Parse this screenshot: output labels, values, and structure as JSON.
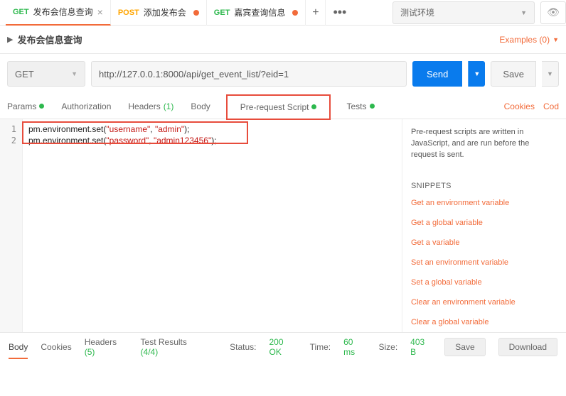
{
  "tabs": [
    {
      "method": "GET",
      "label": "发布会信息查询",
      "active": true
    },
    {
      "method": "POST",
      "label": "添加发布会",
      "active": false
    },
    {
      "method": "GET",
      "label": "嘉宾查询信息",
      "active": false
    }
  ],
  "environment": "测试环境",
  "request": {
    "title": "发布会信息查询",
    "examples": "Examples (0)",
    "method": "GET",
    "url": "http://127.0.0.1:8000/api/get_event_list/?eid=1",
    "send": "Send",
    "save": "Save"
  },
  "req_tabs": {
    "params": "Params",
    "authorization": "Authorization",
    "headers": "Headers",
    "headers_count": "(1)",
    "body": "Body",
    "prerequest": "Pre-request Script",
    "tests": "Tests",
    "cookies": "Cookies",
    "code": "Cod"
  },
  "editor": {
    "line1_a": "pm.environment.set(",
    "line1_s1": "\"username\"",
    "line1_b": ", ",
    "line1_s2": "\"admin\"",
    "line1_c": ");",
    "line2_a": "pm.environment.set(",
    "line2_s1": "\"password\"",
    "line2_b": ", ",
    "line2_s2": "\"admin123456\"",
    "line2_c": ");"
  },
  "side": {
    "desc": "Pre-request scripts are written in JavaScript, and are run before the request is sent.",
    "heading": "SNIPPETS",
    "snippets": [
      "Get an environment variable",
      "Get a global variable",
      "Get a variable",
      "Set an environment variable",
      "Set a global variable",
      "Clear an environment variable",
      "Clear a global variable"
    ]
  },
  "footer": {
    "body": "Body",
    "cookies": "Cookies",
    "headers": "Headers",
    "headers_count": "(5)",
    "testresults": "Test Results",
    "testresults_count": "(4/4)",
    "status_lbl": "Status:",
    "status": "200 OK",
    "time_lbl": "Time:",
    "time": "60 ms",
    "size_lbl": "Size:",
    "size": "403 B",
    "save": "Save",
    "download": "Download"
  }
}
